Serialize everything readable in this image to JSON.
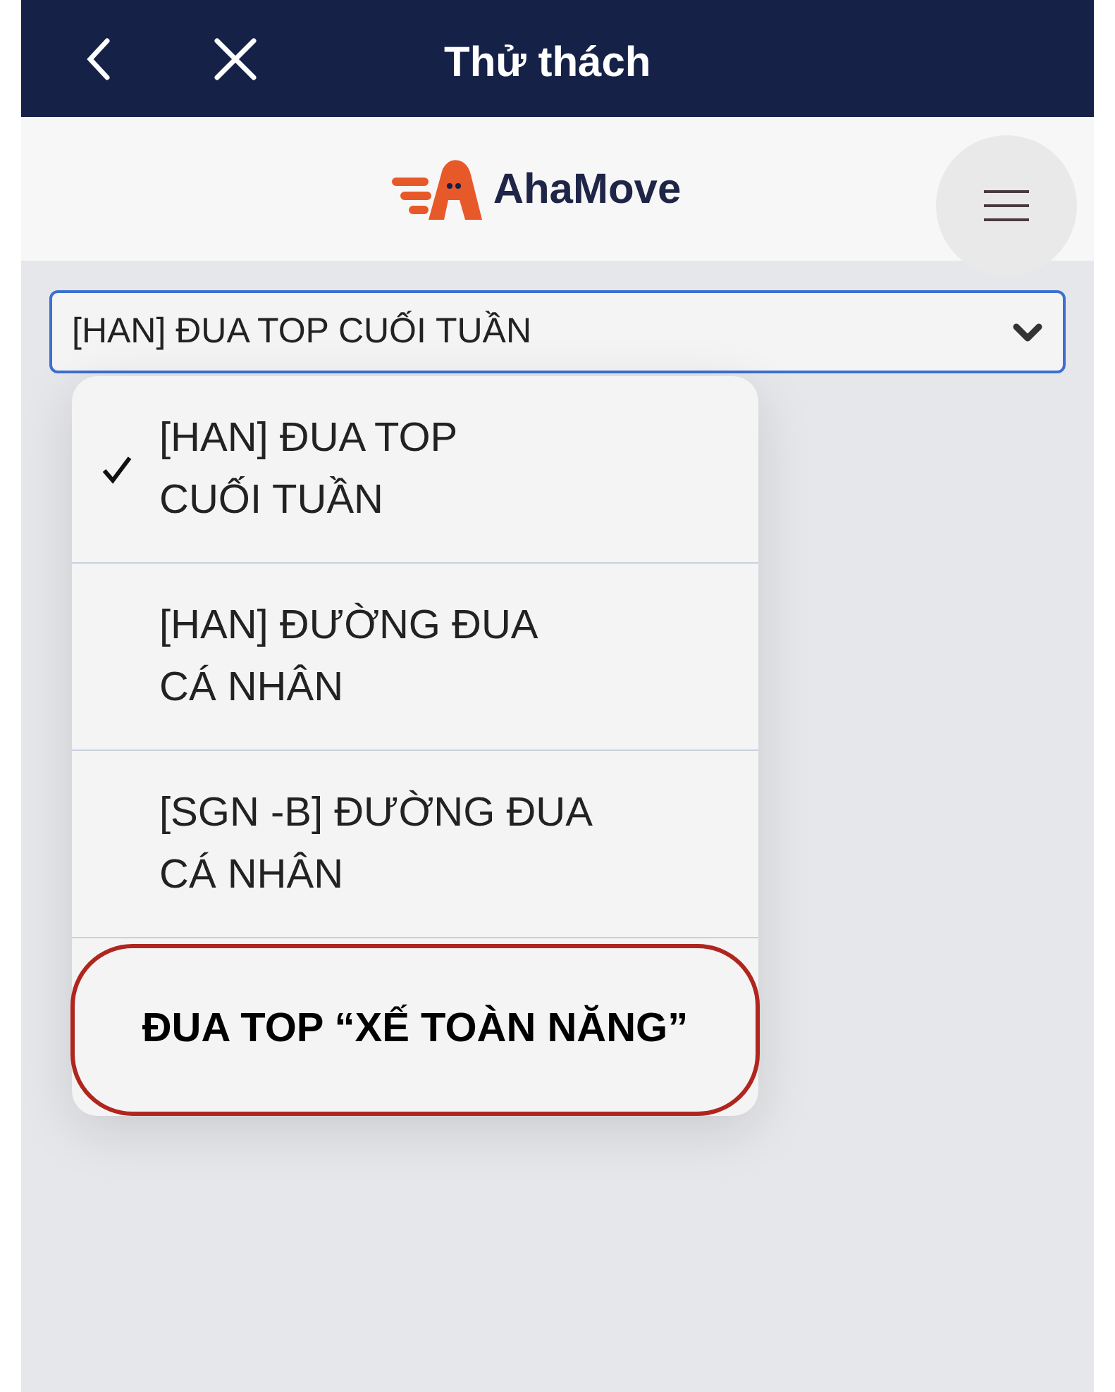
{
  "header": {
    "title": "Thử thách"
  },
  "brand": {
    "name": "AhaMove"
  },
  "select": {
    "value": "[HAN] ĐUA TOP CUỐI TUẦN"
  },
  "options": [
    {
      "lines": [
        "[HAN] ĐUA TOP",
        "CUỐI TUẦN"
      ],
      "selected": true,
      "highlighted": false
    },
    {
      "lines": [
        "[HAN] ĐƯỜNG ĐUA",
        "CÁ NHÂN"
      ],
      "selected": false,
      "highlighted": false
    },
    {
      "lines": [
        "[SGN -B] ĐƯỜNG ĐUA",
        "CÁ NHÂN"
      ],
      "selected": false,
      "highlighted": false
    },
    {
      "lines": [
        "ĐUA TOP “XẾ TOÀN NĂNG”"
      ],
      "selected": false,
      "highlighted": true
    }
  ]
}
